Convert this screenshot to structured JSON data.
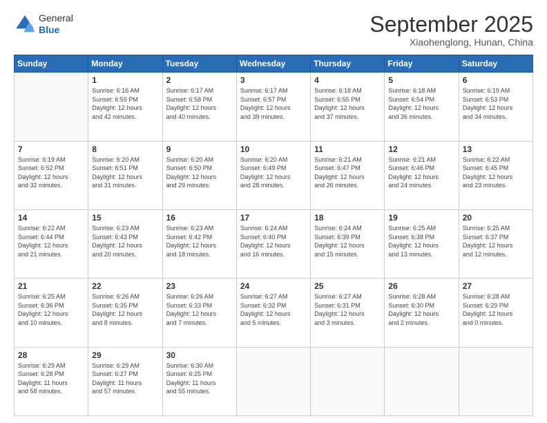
{
  "header": {
    "logo_general": "General",
    "logo_blue": "Blue",
    "title": "September 2025",
    "location": "Xiaohenglong, Hunan, China"
  },
  "days_of_week": [
    "Sunday",
    "Monday",
    "Tuesday",
    "Wednesday",
    "Thursday",
    "Friday",
    "Saturday"
  ],
  "weeks": [
    [
      {
        "day": "",
        "info": ""
      },
      {
        "day": "1",
        "info": "Sunrise: 6:16 AM\nSunset: 6:59 PM\nDaylight: 12 hours\nand 42 minutes."
      },
      {
        "day": "2",
        "info": "Sunrise: 6:17 AM\nSunset: 6:58 PM\nDaylight: 12 hours\nand 40 minutes."
      },
      {
        "day": "3",
        "info": "Sunrise: 6:17 AM\nSunset: 6:57 PM\nDaylight: 12 hours\nand 39 minutes."
      },
      {
        "day": "4",
        "info": "Sunrise: 6:18 AM\nSunset: 6:55 PM\nDaylight: 12 hours\nand 37 minutes."
      },
      {
        "day": "5",
        "info": "Sunrise: 6:18 AM\nSunset: 6:54 PM\nDaylight: 12 hours\nand 36 minutes."
      },
      {
        "day": "6",
        "info": "Sunrise: 6:19 AM\nSunset: 6:53 PM\nDaylight: 12 hours\nand 34 minutes."
      }
    ],
    [
      {
        "day": "7",
        "info": "Sunrise: 6:19 AM\nSunset: 6:52 PM\nDaylight: 12 hours\nand 32 minutes."
      },
      {
        "day": "8",
        "info": "Sunrise: 6:20 AM\nSunset: 6:51 PM\nDaylight: 12 hours\nand 31 minutes."
      },
      {
        "day": "9",
        "info": "Sunrise: 6:20 AM\nSunset: 6:50 PM\nDaylight: 12 hours\nand 29 minutes."
      },
      {
        "day": "10",
        "info": "Sunrise: 6:20 AM\nSunset: 6:49 PM\nDaylight: 12 hours\nand 28 minutes."
      },
      {
        "day": "11",
        "info": "Sunrise: 6:21 AM\nSunset: 6:47 PM\nDaylight: 12 hours\nand 26 minutes."
      },
      {
        "day": "12",
        "info": "Sunrise: 6:21 AM\nSunset: 6:46 PM\nDaylight: 12 hours\nand 24 minutes."
      },
      {
        "day": "13",
        "info": "Sunrise: 6:22 AM\nSunset: 6:45 PM\nDaylight: 12 hours\nand 23 minutes."
      }
    ],
    [
      {
        "day": "14",
        "info": "Sunrise: 6:22 AM\nSunset: 6:44 PM\nDaylight: 12 hours\nand 21 minutes."
      },
      {
        "day": "15",
        "info": "Sunrise: 6:23 AM\nSunset: 6:43 PM\nDaylight: 12 hours\nand 20 minutes."
      },
      {
        "day": "16",
        "info": "Sunrise: 6:23 AM\nSunset: 6:42 PM\nDaylight: 12 hours\nand 18 minutes."
      },
      {
        "day": "17",
        "info": "Sunrise: 6:24 AM\nSunset: 6:40 PM\nDaylight: 12 hours\nand 16 minutes."
      },
      {
        "day": "18",
        "info": "Sunrise: 6:24 AM\nSunset: 6:39 PM\nDaylight: 12 hours\nand 15 minutes."
      },
      {
        "day": "19",
        "info": "Sunrise: 6:25 AM\nSunset: 6:38 PM\nDaylight: 12 hours\nand 13 minutes."
      },
      {
        "day": "20",
        "info": "Sunrise: 6:25 AM\nSunset: 6:37 PM\nDaylight: 12 hours\nand 12 minutes."
      }
    ],
    [
      {
        "day": "21",
        "info": "Sunrise: 6:25 AM\nSunset: 6:36 PM\nDaylight: 12 hours\nand 10 minutes."
      },
      {
        "day": "22",
        "info": "Sunrise: 6:26 AM\nSunset: 6:35 PM\nDaylight: 12 hours\nand 8 minutes."
      },
      {
        "day": "23",
        "info": "Sunrise: 6:26 AM\nSunset: 6:33 PM\nDaylight: 12 hours\nand 7 minutes."
      },
      {
        "day": "24",
        "info": "Sunrise: 6:27 AM\nSunset: 6:32 PM\nDaylight: 12 hours\nand 5 minutes."
      },
      {
        "day": "25",
        "info": "Sunrise: 6:27 AM\nSunset: 6:31 PM\nDaylight: 12 hours\nand 3 minutes."
      },
      {
        "day": "26",
        "info": "Sunrise: 6:28 AM\nSunset: 6:30 PM\nDaylight: 12 hours\nand 2 minutes."
      },
      {
        "day": "27",
        "info": "Sunrise: 6:28 AM\nSunset: 6:29 PM\nDaylight: 12 hours\nand 0 minutes."
      }
    ],
    [
      {
        "day": "28",
        "info": "Sunrise: 6:29 AM\nSunset: 6:28 PM\nDaylight: 11 hours\nand 58 minutes."
      },
      {
        "day": "29",
        "info": "Sunrise: 6:29 AM\nSunset: 6:27 PM\nDaylight: 11 hours\nand 57 minutes."
      },
      {
        "day": "30",
        "info": "Sunrise: 6:30 AM\nSunset: 6:25 PM\nDaylight: 11 hours\nand 55 minutes."
      },
      {
        "day": "",
        "info": ""
      },
      {
        "day": "",
        "info": ""
      },
      {
        "day": "",
        "info": ""
      },
      {
        "day": "",
        "info": ""
      }
    ]
  ]
}
